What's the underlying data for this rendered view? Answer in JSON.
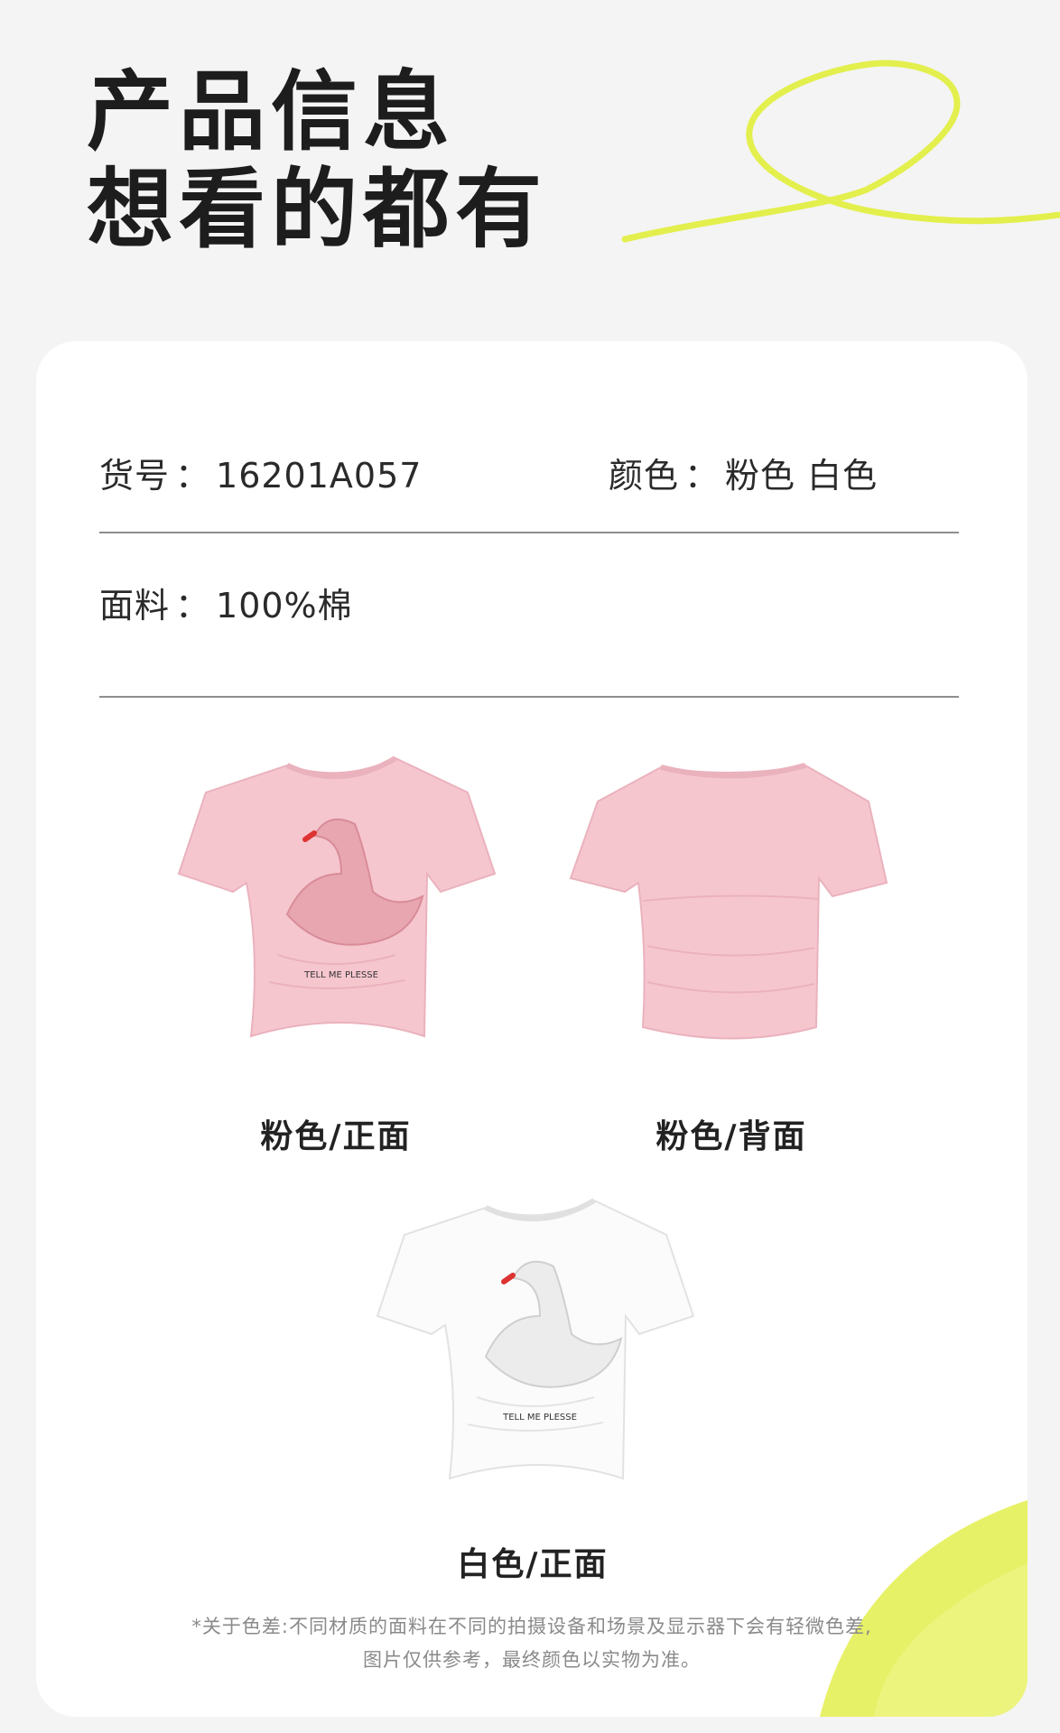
{
  "header": {
    "line1": "产品信息",
    "line2": "想看的都有"
  },
  "specs": {
    "item_no_label": "货号",
    "item_no_value": "16201A057",
    "color_label": "颜色",
    "color_value": "粉色 白色",
    "fabric_label": "面料",
    "fabric_value": "100%棉",
    "separator": "："
  },
  "products": [
    {
      "caption": "粉色/正面",
      "print": "TELL ME PLESSE"
    },
    {
      "caption": "粉色/背面"
    },
    {
      "caption": "白色/正面",
      "print": "TELL ME PLESSE"
    }
  ],
  "note": {
    "line1": "*关于色差:不同材质的面料在不同的拍摄设备和场景及显示器下会有轻微色差,",
    "line2": "图片仅供参考，最终颜色以实物为准。"
  },
  "colors": {
    "background": "#f4f4f4",
    "card": "#ffffff",
    "accent_yellow": "#e3ef4c",
    "pink": "#f6c6cf",
    "white_shirt": "#fbfbfb"
  }
}
